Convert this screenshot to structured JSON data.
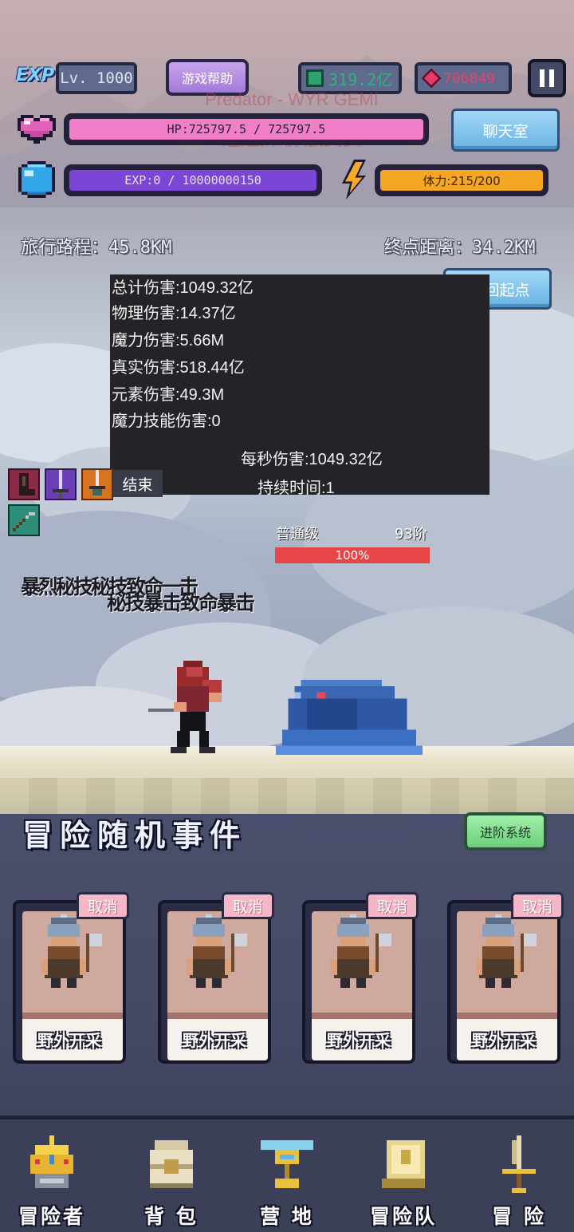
{
  "header": {
    "exp_badge": "EXP",
    "level": "Lv. 1000",
    "help_button": "游戏帮助",
    "gems": "319.2亿",
    "rubies": "706849",
    "hp_text": "HP:725797.5 / 725797.5",
    "exp_text": "EXP:0 / 10000000150",
    "stamina_text": "体力:215/200",
    "chat_button": "聊天室",
    "watermark_line1": "Predator - WYR GEMI",
    "watermark_line2": "迅速升级·放奖赏"
  },
  "progress": {
    "travel": "旅行路程：45.8KM",
    "remaining": "终点距离：34.2KM",
    "back_button": "回起点"
  },
  "damage_stats": {
    "total": "总计伤害:1049.32亿",
    "physical": "物理伤害:14.37亿",
    "magic": "魔力伤害:5.66M",
    "true_dmg": "真实伤害:518.44亿",
    "element": "元素伤害:49.3M",
    "magic_skill": "魔力技能伤害:0",
    "dps": "每秒伤害:1049.32亿",
    "duration": "持续时间:1",
    "end_button": "结束"
  },
  "enemy": {
    "rank": "普通级",
    "tier": "93阶",
    "hp_percent_label": "100%",
    "hp_fraction": 1.0
  },
  "combat_text": {
    "line1": "暴烈秘技秘技致命一击",
    "line2": "秘技暴击致命暴击"
  },
  "events": {
    "title": "冒险随机事件",
    "advance_button": "进阶系统",
    "cards": [
      {
        "label": "野外开采",
        "cancel": "取消"
      },
      {
        "label": "野外开采",
        "cancel": "取消"
      },
      {
        "label": "野外开采",
        "cancel": "取消"
      },
      {
        "label": "野外开采",
        "cancel": "取消"
      }
    ]
  },
  "nav": {
    "items": [
      {
        "label": "冒险者",
        "icon": "crown-icon"
      },
      {
        "label": "背 包",
        "icon": "backpack-icon"
      },
      {
        "label": "营 地",
        "icon": "trophy-icon"
      },
      {
        "label": "冒险队",
        "icon": "book-icon"
      },
      {
        "label": "冒 险",
        "icon": "sword-icon"
      }
    ]
  },
  "colors": {
    "hp_bar": "#f07fc8",
    "exp_bar": "#7b45d6",
    "stamina_bar": "#f5a623",
    "enemy_hp": "#e64646",
    "accent_blue": "#69b4e4",
    "advance_green": "#7bd98a"
  }
}
